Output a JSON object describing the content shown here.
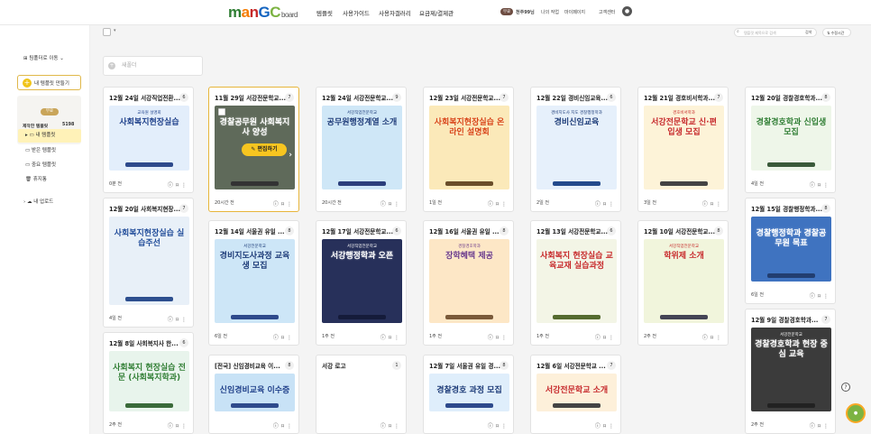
{
  "header": {
    "logo_text": [
      "m",
      "a",
      "n",
      "G",
      "C"
    ],
    "logo_sub": "board",
    "nav": [
      "템플릿",
      "사용가이드",
      "사용자갤러리",
      "요금제/결제관"
    ],
    "plan_badge": "무료",
    "user_name": "천주99님",
    "user_links": [
      "나의 작업",
      "마이페이지",
      "고객센터"
    ]
  },
  "sidebar": {
    "goto_folder": "팀폴더로 이동",
    "new_template": "내 템플릿 만들기",
    "plan_label": "무료",
    "stats": [
      {
        "label": "제작한 템플릿",
        "value": "5198"
      },
      {
        "label": "제작 가능 개수",
        "value": "무제한"
      }
    ],
    "menu": [
      {
        "label": "내 템플릿",
        "active": true
      },
      {
        "label": "받은 템플릿",
        "active": false
      },
      {
        "label": "중요 템플릿",
        "active": false
      },
      {
        "label": "휴지통",
        "active": false
      }
    ],
    "upload": "내 업로드"
  },
  "toolbar": {
    "search_placeholder": "템플릿 제목으로 검색",
    "search_btn": "검색",
    "sort_label": "수정시간"
  },
  "folder_placeholder": "새폴더",
  "edit_label": "편집하기",
  "cards": [
    {
      "title": "12월 24일 서강직업전환...",
      "count": "6",
      "date": "0분 전",
      "bg": "#e3eefb",
      "hl": "사회복지현장실습",
      "hlc": "#1c3f8a",
      "sub": "교육원 설명회",
      "foot": "#2e4a8c"
    },
    {
      "title": "11월 29일 서강전문학교...",
      "count": "7",
      "date": "20시간 전",
      "bg": "#5f6a5a",
      "hl": "경찰공무원 사회복지사 양성",
      "hlc": "#ffffff",
      "sub": "",
      "foot": "#333",
      "selected": true
    },
    {
      "title": "12월 24일 서강전문학교...",
      "count": "9",
      "date": "20시간 전",
      "bg": "#cfe7f7",
      "hl": "공무원행정계열 소개",
      "hlc": "#1d3c7a",
      "sub": "서강직업전문학교",
      "foot": "#2b3f7c"
    },
    {
      "title": "12월 23일 서강전문학교...",
      "count": "7",
      "date": "1일 전",
      "bg": "#fbe9b9",
      "hl": "사회복지현장실습 온라인 설명회",
      "hlc": "#d84315",
      "sub": "",
      "foot": "#6a4e2a"
    },
    {
      "title": "12월 22일 경비신임교육...",
      "count": "6",
      "date": "2일 전",
      "bg": "#e6f0fb",
      "hl": "경비신임교육",
      "hlc": "#1b3b78",
      "sub": "경비지도사 지도 경찰행정학과",
      "foot": "#234a8c"
    },
    {
      "title": "12월 21일 경호비서학과...",
      "count": "7",
      "date": "3일 전",
      "bg": "#fdf3d8",
      "hl": "서강전문학교 신·편입생 모집",
      "hlc": "#c62828",
      "sub": "경호비서학과",
      "foot": "#444"
    },
    {
      "title": "12월 20일 경찰경호학과...",
      "count": "8",
      "date": "4일 전",
      "bg": "#eef6e9",
      "hl": "경찰경호학과 신입생 모집",
      "hlc": "#2e7d32",
      "sub": "",
      "foot": "#3a5a3a"
    },
    {
      "title": "12월 20일 사회복지현장...",
      "count": "7",
      "date": "4일 전",
      "bg": "#e8f0f8",
      "hl": "사회복지현장실습 실습주선",
      "hlc": "#1f4b99",
      "sub": "",
      "foot": "#2d4f8f"
    },
    {
      "title": "12월 14일 서울권 유일 ...",
      "count": "8",
      "date": "6일 전",
      "bg": "#cde6f7",
      "hl": "경비지도사과정 교육생 모집",
      "hlc": "#1a3a78",
      "sub": "서강전문학교",
      "foot": "#2e4a8c"
    },
    {
      "title": "12월 17일 서강전문학교...",
      "count": "6",
      "date": "1주 전",
      "bg": "#27305a",
      "hl": "서강행정학과 오픈",
      "hlc": "#ffffff",
      "sub": "서강직업전문학교",
      "foot": "#151b3a"
    },
    {
      "title": "12월 16일 서울권 유일 ...",
      "count": "8",
      "date": "1주 전",
      "bg": "#fde7c6",
      "hl": "장학혜택 제공",
      "hlc": "#6b3a8a",
      "sub": "경찰경호학과",
      "foot": "#7a5a3a"
    },
    {
      "title": "12월 13일 서강전문학교...",
      "count": "6",
      "date": "1주 전",
      "bg": "#f3f5e6",
      "hl": "사회복지 현장실습 교육교재 실습과정",
      "hlc": "#c62828",
      "sub": "",
      "foot": "#556b2f"
    },
    {
      "title": "12월 10일 서강전문학교...",
      "count": "8",
      "date": "2주 전",
      "bg": "#f1f5dc",
      "hl": "학위제 소개",
      "hlc": "#c62828",
      "sub": "서강직업전문학교",
      "foot": "#445"
    },
    {
      "title": "12월 15일 경찰행정학과...",
      "count": "8",
      "date": "6일 전",
      "bg": "#3f73c0",
      "hl": "경찰행정학과 경찰공무원 목표",
      "hlc": "#ffffff",
      "sub": "",
      "foot": "#223e70"
    },
    {
      "title": "12월 8일 사회복지사 한...",
      "count": "6",
      "date": "2주 전",
      "bg": "#e8f4ec",
      "hl": "사회복지 현장실습 전문 (사회복지학과)",
      "hlc": "#2e7d32",
      "sub": "",
      "foot": "#3a6a3a"
    },
    {
      "title": "[전국] 신임경비교육 이...",
      "count": "8",
      "date": "",
      "bg": "#c8e2f6",
      "hl": "신임경비교육 이수증",
      "hlc": "#1c3f8a",
      "sub": "",
      "foot": "#2e4a8c"
    },
    {
      "title": "서강 로고",
      "count": "1",
      "date": "",
      "bg": "#ffffff",
      "hl": "",
      "hlc": "#000",
      "sub": "",
      "foot": "#fff"
    },
    {
      "title": "12월 7일 서울권 유일 경...",
      "count": "8",
      "date": "",
      "bg": "#dfeefb",
      "hl": "경찰경호 과정 모집",
      "hlc": "#1a3a78",
      "sub": "",
      "foot": "#2e4a8c"
    },
    {
      "title": "12월 6일 서강전문학교 ...",
      "count": "7",
      "date": "",
      "bg": "#fdf0da",
      "hl": "서강전문학교 소개",
      "hlc": "#c62828",
      "sub": "",
      "foot": "#444"
    },
    {
      "title": "12월 9일 경찰경호학과...",
      "count": "7",
      "date": "2주 전",
      "bg": "#3b3b3b",
      "hl": "경찰경호학과 현장 중심 교육",
      "hlc": "#ffffff",
      "sub": "서강전문학교",
      "foot": "#222"
    }
  ]
}
